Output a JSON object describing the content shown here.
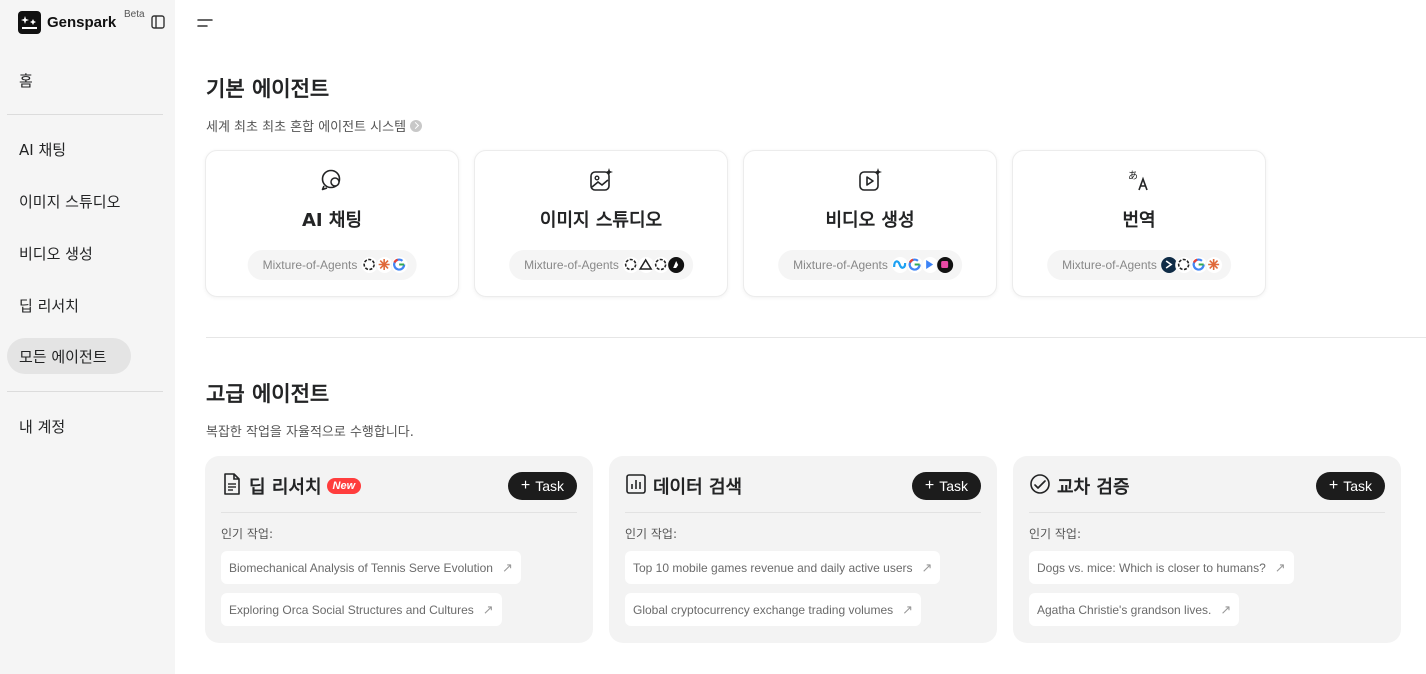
{
  "sidebar": {
    "brand": "Genspark",
    "beta": "Beta",
    "nav": {
      "home": "홈",
      "ai_chat": "AI 채팅",
      "image_studio": "이미지 스튜디오",
      "video": "비디오 생성",
      "deep_research": "딥 리서치",
      "all_agents": "모든 에이전트",
      "account": "내 계정"
    },
    "active_item": "all_agents"
  },
  "basic": {
    "title": "기본 에이전트",
    "subtitle": "세계 최초 최초 혼합 에이전트 시스템",
    "cards": [
      {
        "title": "AI 채팅",
        "tag": "Mixture-of-Agents",
        "icon": "chat-icon",
        "logos": [
          "openai",
          "claude",
          "google"
        ]
      },
      {
        "title": "이미지 스튜디오",
        "tag": "Mixture-of-Agents",
        "icon": "image-sparkle-icon",
        "logos": [
          "openai",
          "flux",
          "openai",
          "ideogram"
        ]
      },
      {
        "title": "비디오 생성",
        "tag": "Mixture-of-Agents",
        "icon": "video-sparkle-icon",
        "logos": [
          "meta",
          "google",
          "luma",
          "pika"
        ]
      },
      {
        "title": "번역",
        "tag": "Mixture-of-Agents",
        "icon": "translate-icon",
        "logos": [
          "deepl",
          "openai",
          "google",
          "claude"
        ]
      }
    ]
  },
  "advanced": {
    "title": "고급 에이전트",
    "subtitle": "복잡한 작업을 자율적으로 수행합니다.",
    "popular_label": "인기 작업:",
    "task_label": "Task",
    "new_badge": "New",
    "cards": [
      {
        "title": "딥 리서치",
        "icon": "document-icon",
        "items": [
          "Biomechanical Analysis of Tennis Serve Evolution",
          "Exploring Orca Social Structures and Cultures"
        ]
      },
      {
        "title": "데이터 검색",
        "icon": "bar-chart-icon",
        "items": [
          "Top 10 mobile games revenue and daily active users",
          "Global cryptocurrency exchange trading volumes"
        ]
      },
      {
        "title": "교차 검증",
        "icon": "check-trend-icon",
        "items": [
          "Dogs vs. mice: Which is closer to humans?",
          "Agatha Christie's grandson lives."
        ]
      }
    ]
  },
  "colors": {
    "sidebar_bg": "#f5f5f5",
    "active_nav": "#e4e4e4",
    "task_button": "#1c1c1c",
    "new_badge": "#ff3d3d"
  }
}
